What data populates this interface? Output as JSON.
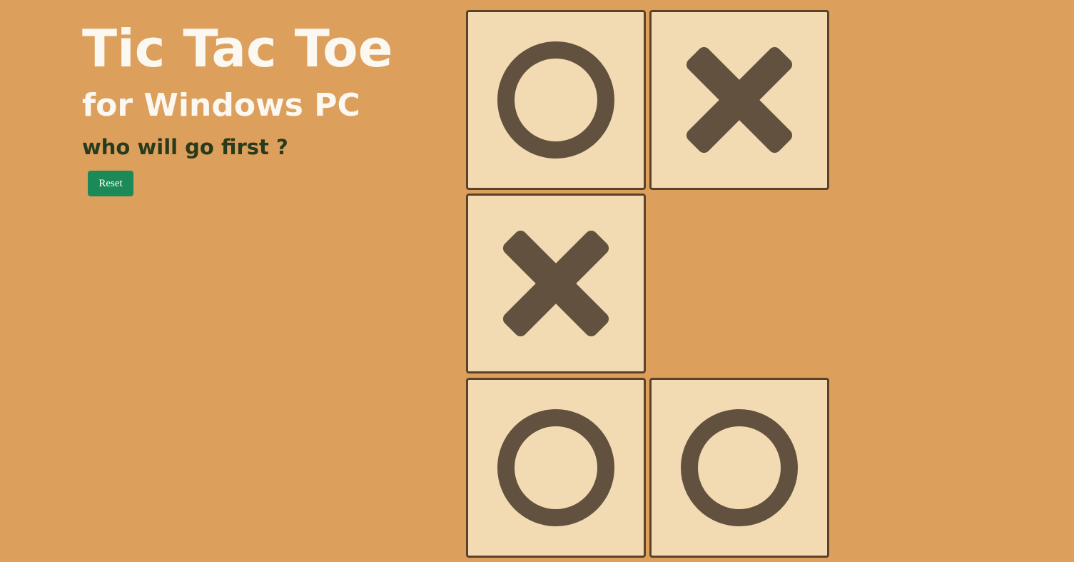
{
  "header": {
    "title": "Tic Tac Toe",
    "subtitle": "for Windows PC",
    "prompt": "who will go first ?"
  },
  "controls": {
    "reset_label": "Reset"
  },
  "board": {
    "cells": [
      "O",
      "X",
      "",
      "X",
      "",
      "",
      "O",
      "O",
      ""
    ]
  },
  "colors": {
    "background": "#dca05c",
    "cell": "#f2dbb3",
    "mark": "#635140",
    "button": "#1c8a58"
  }
}
